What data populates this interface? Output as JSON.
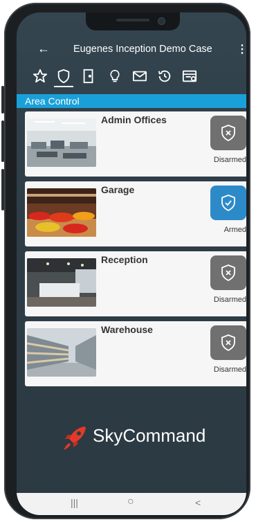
{
  "app": {
    "title": "Eugenes Inception Demo Case",
    "back_icon": "arrow-left-icon",
    "menu_icon": "more-vertical-icon"
  },
  "tabs": [
    {
      "icon": "star-icon"
    },
    {
      "icon": "shield-icon",
      "active": true
    },
    {
      "icon": "door-icon"
    },
    {
      "icon": "lightbulb-icon"
    },
    {
      "icon": "mail-icon"
    },
    {
      "icon": "history-icon"
    },
    {
      "icon": "calendar-icon"
    }
  ],
  "section": {
    "title": "Area Control"
  },
  "areas": [
    {
      "name": "Admin Offices",
      "status": "Disarmed"
    },
    {
      "name": "Garage",
      "status": "Armed"
    },
    {
      "name": "Reception",
      "status": "Disarmed"
    },
    {
      "name": "Warehouse",
      "status": "Disarmed"
    }
  ],
  "brand": {
    "name": "SkyCommand"
  },
  "nav": {
    "recents": "|||",
    "home": "○",
    "back": "<"
  },
  "colors": {
    "accent": "#1aa0d8",
    "armed": "#2d8ac8",
    "disarmed": "#707070",
    "brand_red": "#e23a2a"
  }
}
